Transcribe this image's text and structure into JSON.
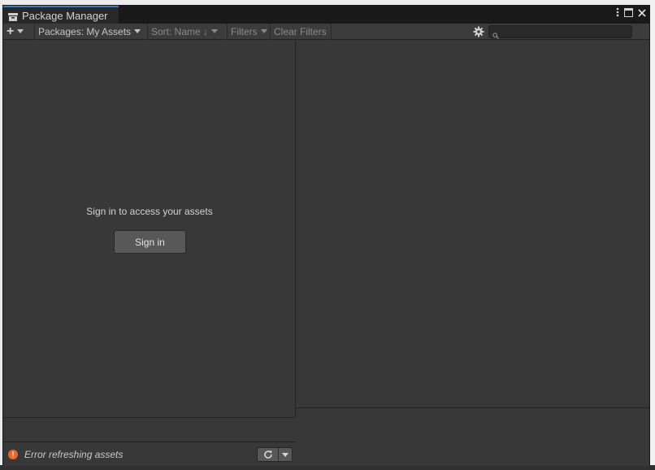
{
  "window": {
    "tab_title": "Package Manager"
  },
  "toolbar": {
    "packages_label": "Packages: My Assets",
    "sort_label": "Sort: Name ↓",
    "filters_label": "Filters",
    "clear_filters_label": "Clear Filters",
    "search_placeholder": ""
  },
  "main": {
    "sign_in_message": "Sign in to access your assets",
    "sign_in_button": "Sign in"
  },
  "status": {
    "error_text": "Error refreshing assets"
  },
  "colors": {
    "accent": "#3a79bb",
    "error": "#e06a2f",
    "panel_bg": "#383838"
  }
}
